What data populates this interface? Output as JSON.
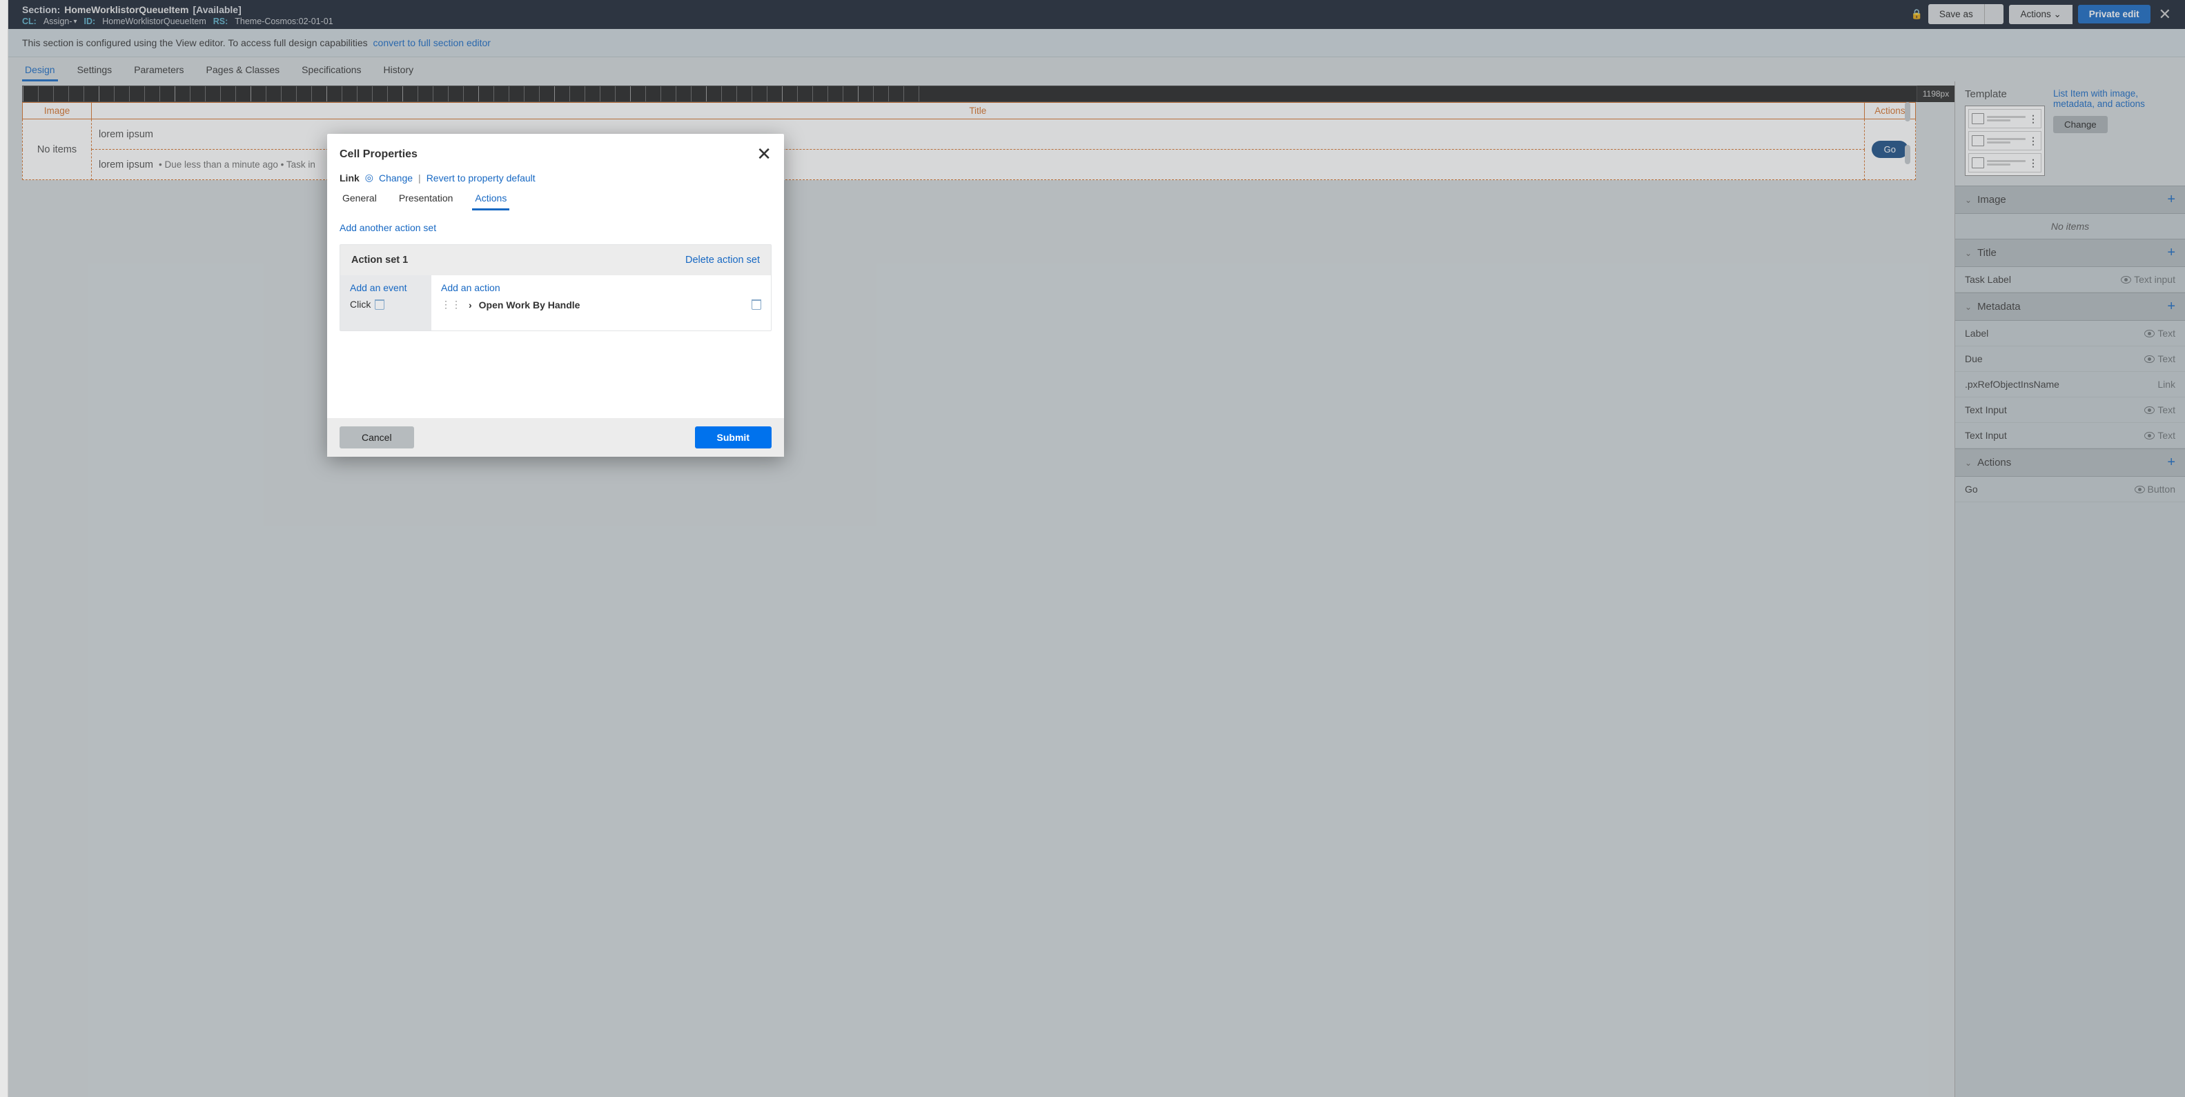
{
  "header": {
    "section_label": "Section:",
    "section_name": "HomeWorklistorQueueItem",
    "availability": "[Available]",
    "cl_label": "CL:",
    "cl_value": "Assign-",
    "id_label": "ID:",
    "id_value": "HomeWorklistorQueueItem",
    "rs_label": "RS:",
    "rs_value": "Theme-Cosmos:02-01-01",
    "save_as": "Save as",
    "actions": "Actions",
    "private_edit": "Private edit"
  },
  "banner": {
    "text": "This section is configured using the View editor. To access full design capabilities",
    "link": "convert to full section editor"
  },
  "tabs": [
    "Design",
    "Settings",
    "Parameters",
    "Pages & Classes",
    "Specifications",
    "History"
  ],
  "canvas": {
    "px": "1198px",
    "col_image": "Image",
    "col_title": "Title",
    "col_actions": "Actions",
    "no_items": "No items",
    "lorem1": "lorem ipsum",
    "lorem2": "lorem ipsum",
    "sub_text": "•  Due less than a minute ago   •  Task in",
    "go": "Go"
  },
  "rightbar": {
    "template_title": "Template",
    "template_desc": "List Item with image, metadata, and actions",
    "change": "Change",
    "sections": {
      "image": "Image",
      "image_empty": "No items",
      "title": "Title",
      "metadata": "Metadata",
      "actions": "Actions"
    },
    "rows": {
      "task_label": "Task Label",
      "task_label_type": "Text input",
      "label": "Label",
      "label_type": "Text",
      "due": "Due",
      "due_type": "Text",
      "pxref": ".pxRefObjectInsName",
      "pxref_type": "Link",
      "text_input1": "Text Input",
      "text_input1_type": "Text",
      "text_input2": "Text Input",
      "text_input2_type": "Text",
      "go": "Go",
      "go_type": "Button"
    }
  },
  "modal": {
    "title": "Cell Properties",
    "link_label": "Link",
    "change": "Change",
    "revert": "Revert to property default",
    "tabs": [
      "General",
      "Presentation",
      "Actions"
    ],
    "add_set": "Add another action set",
    "set_title": "Action set 1",
    "delete_set": "Delete action set",
    "add_event": "Add an event",
    "event_click": "Click",
    "add_action": "Add an action",
    "action_name": "Open Work By Handle",
    "cancel": "Cancel",
    "submit": "Submit"
  }
}
